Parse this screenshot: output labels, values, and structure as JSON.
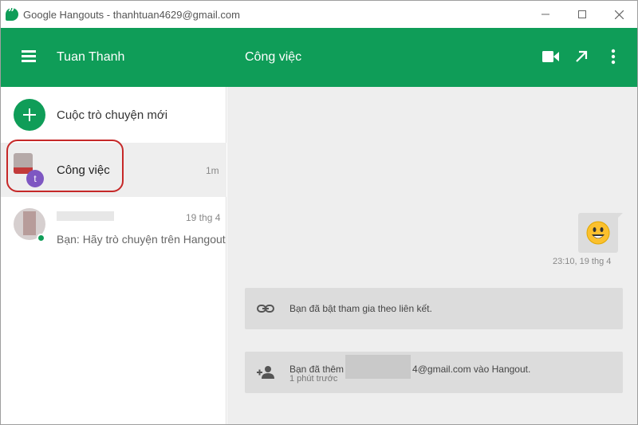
{
  "window": {
    "title": "Google Hangouts - thanhtuan4629@gmail.com",
    "controls": [
      "minimize-icon",
      "maximize-icon",
      "close-icon"
    ]
  },
  "header": {
    "user_name": "Tuan Thanh",
    "conversation_title": "Công việc",
    "accent_color": "#0f9d58",
    "icons": [
      "menu-icon",
      "video-call-icon",
      "pop-out-icon",
      "more-options-icon"
    ]
  },
  "sidebar": {
    "new_conversation_label": "Cuộc trò chuyện mới",
    "conversations": [
      {
        "name": "Công việc",
        "avatar_letter": "t",
        "time": "1m",
        "active": true
      },
      {
        "name": "",
        "time": "19 thg 4",
        "preview": "Bạn: Hãy trò chuyện trên Hangout",
        "online": true
      }
    ]
  },
  "chat": {
    "message_emoji": "😃",
    "message_time": "23:10, 19 thg 4",
    "events": [
      {
        "icon": "link-icon",
        "text": "Bạn đã bật tham gia theo liên kết."
      },
      {
        "icon": "add-person-icon",
        "text_prefix": "Bạn đã thêm",
        "text_suffix": "4@gmail.com vào Hangout.",
        "sub": "1 phút trước"
      }
    ]
  }
}
